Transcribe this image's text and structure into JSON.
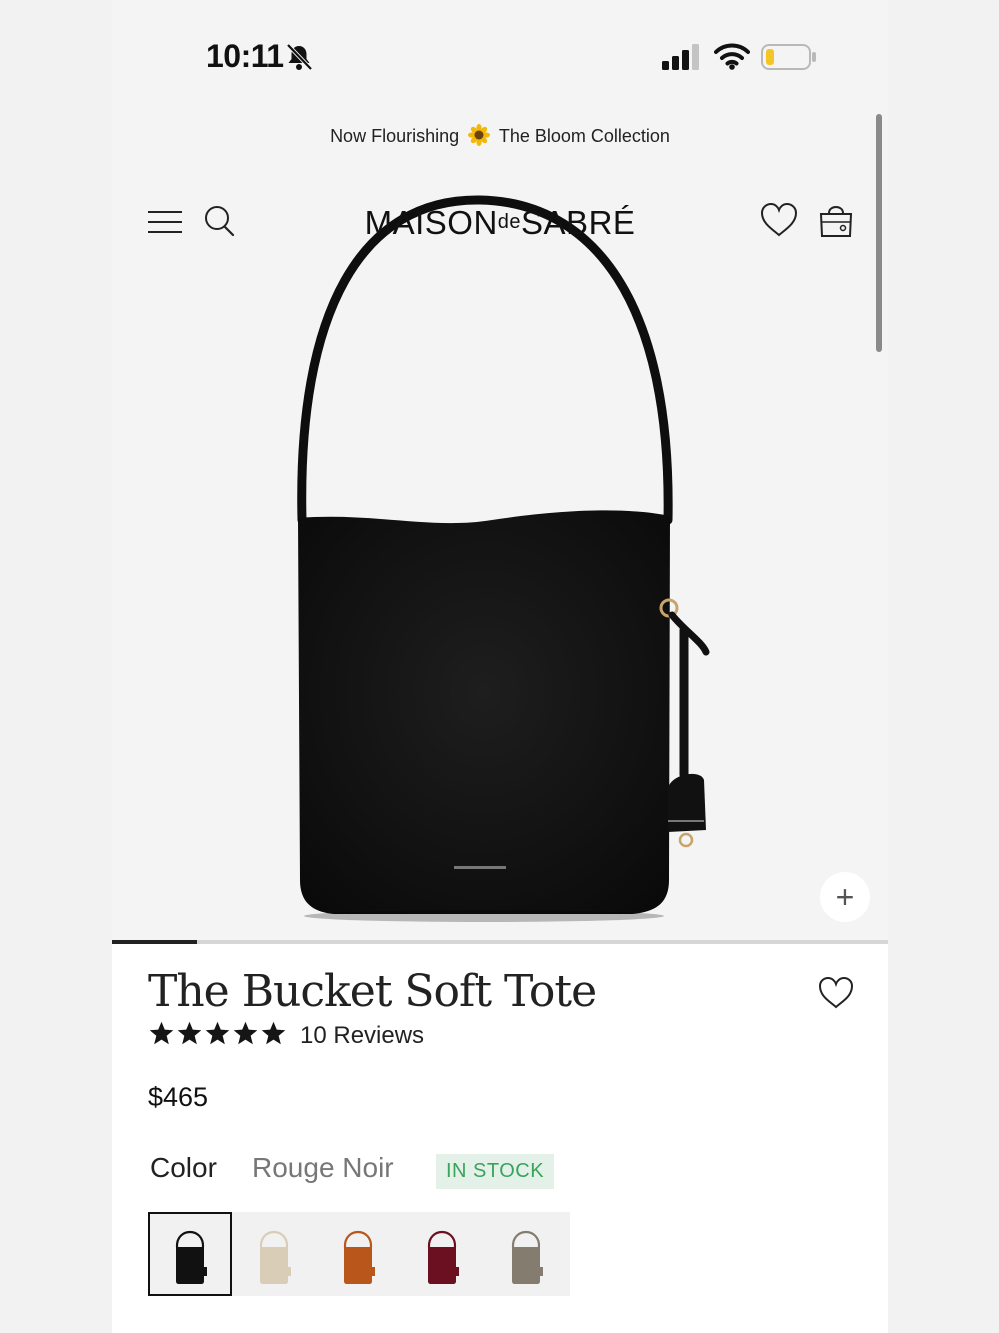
{
  "status_bar": {
    "time": "10:11",
    "icons": [
      "bell-slash-icon",
      "signal-icon",
      "wifi-icon",
      "battery-low-icon"
    ]
  },
  "promo": {
    "text_before": "Now Flourishing",
    "text_after": "The Bloom Collection",
    "icon": "sunflower-icon"
  },
  "header": {
    "logo_left": "MAISON",
    "logo_de": "de",
    "logo_right": "SABRÉ",
    "icons": [
      "menu-icon",
      "search-icon",
      "heart-icon",
      "shopping-bag-icon"
    ]
  },
  "gallery": {
    "zoom_label": "+",
    "image_progress": 0.11
  },
  "product": {
    "title": "The Bucket Soft Tote",
    "rating": 5,
    "reviews_label": "10 Reviews",
    "price": "$465",
    "color_label": "Color",
    "color_value": "Rouge Noir",
    "stock_label": "IN STOCK"
  },
  "swatches": [
    {
      "color": "#111111",
      "selected": true
    },
    {
      "color": "#d9cdb8",
      "selected": false
    },
    {
      "color": "#b8561c",
      "selected": false
    },
    {
      "color": "#6b1020",
      "selected": false
    },
    {
      "color": "#857c70",
      "selected": false
    }
  ],
  "colors": {
    "accent": "#111111",
    "stock_bg": "#e4f1e8",
    "stock_text": "#3aa35c"
  }
}
